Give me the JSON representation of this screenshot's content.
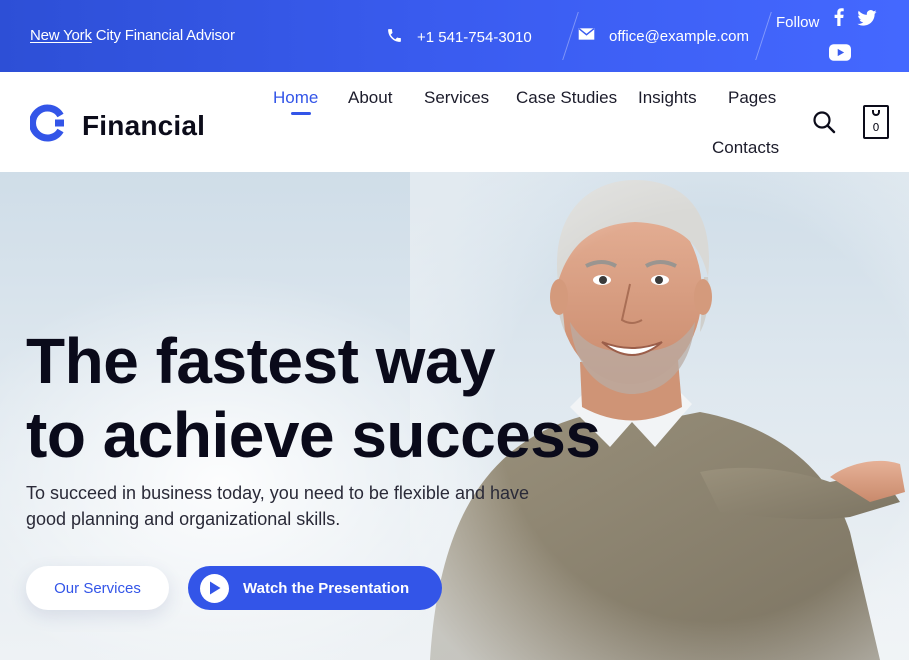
{
  "topbar": {
    "location_underlined": "New York",
    "location_rest": " City Financial Advisor",
    "phone": "+1 541-754-3010",
    "email": "office@example.com",
    "follow_label": "Follow",
    "social_icons": [
      "facebook-icon",
      "twitter-icon",
      "youtube-icon"
    ]
  },
  "header": {
    "logo_text": "Financial",
    "nav": [
      {
        "label": "Home",
        "active": true
      },
      {
        "label": "About"
      },
      {
        "label": "Services"
      },
      {
        "label": "Case Studies"
      },
      {
        "label": "Insights"
      },
      {
        "label": "Pages"
      },
      {
        "label": "Contacts"
      }
    ],
    "cart_count": "0"
  },
  "hero": {
    "title_line1": "The fastest way",
    "title_line2": "to achieve success",
    "subtitle": "To succeed in business today, you need to be flexible and have good planning and organizational skills.",
    "btn_primary": "Our Services",
    "btn_secondary": "Watch the Presentation"
  },
  "colors": {
    "accent": "#3355e8",
    "topbar_gradient_start": "#2d4fd6",
    "topbar_gradient_end": "#4468ff",
    "heading": "#0a0a1a"
  }
}
